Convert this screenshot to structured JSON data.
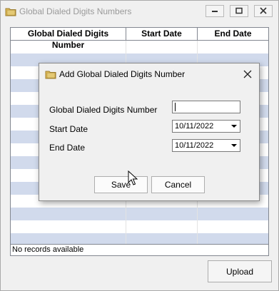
{
  "window": {
    "title": "Global Dialed Digits Numbers",
    "icon": "folder-icon",
    "controls": [
      "minimize-icon",
      "maximize-icon",
      "close-icon"
    ]
  },
  "grid": {
    "columns": [
      "Global Dialed Digits Number",
      "Start Date",
      "End Date"
    ],
    "rows": [],
    "status": "No records available"
  },
  "upload_label": "Upload",
  "dialog": {
    "title": "Add Global Dialed Digits Number",
    "icon": "folder-icon",
    "fields": {
      "number": {
        "label": "Global Dialed Digits Number",
        "value": ""
      },
      "start_date": {
        "label": "Start Date",
        "value": "10/11/2022"
      },
      "end_date": {
        "label": "End Date",
        "value": "10/11/2022"
      }
    },
    "save_label": "Save",
    "cancel_label": "Cancel"
  }
}
